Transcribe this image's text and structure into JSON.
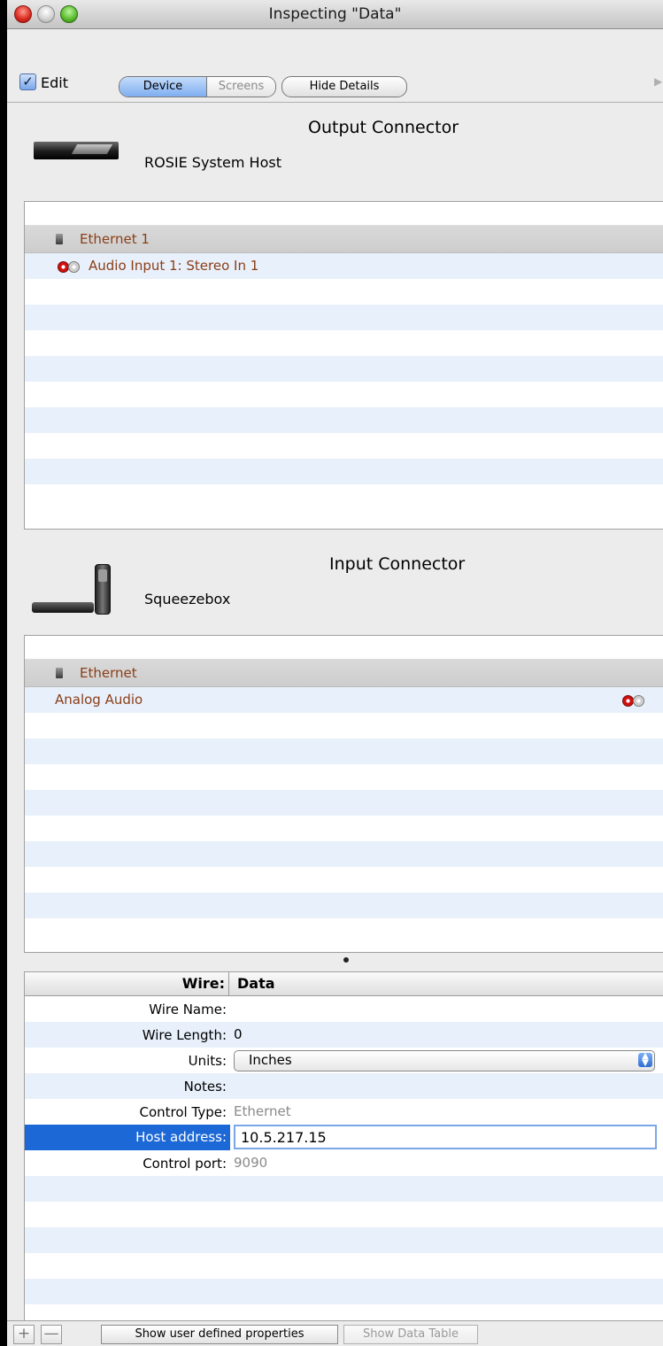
{
  "window": {
    "title": "Inspecting \"Data\""
  },
  "toolbar": {
    "edit_label": "Edit",
    "edit_checked": true,
    "segments": [
      "Device",
      "Screens"
    ],
    "selected_segment": "Device",
    "hide_details_label": "Hide Details"
  },
  "output": {
    "heading": "Output Connector",
    "device_name": "ROSIE System Host",
    "group": "Ethernet 1",
    "rows": [
      {
        "label": "Audio Input 1: Stereo In 1"
      }
    ]
  },
  "input": {
    "heading": "Input Connector",
    "device_name": "Squeezebox",
    "group": "Ethernet",
    "rows": [
      {
        "label": "Analog Audio"
      }
    ]
  },
  "wire": {
    "header_label": "Wire:",
    "header_value": "Data",
    "fields": {
      "wire_name": {
        "label": "Wire Name:",
        "value": ""
      },
      "wire_length": {
        "label": "Wire Length:",
        "value": "0"
      },
      "units": {
        "label": "Units:",
        "value": "Inches"
      },
      "notes": {
        "label": "Notes:",
        "value": ""
      },
      "control_type": {
        "label": "Control Type:",
        "value": "Ethernet"
      },
      "host_address": {
        "label": "Host address:",
        "value": "10.5.217.15"
      },
      "control_port": {
        "label": "Control port:",
        "value": "9090"
      }
    }
  },
  "bottom": {
    "add_label": "+",
    "remove_label": "—",
    "show_user_label": "Show user defined properties",
    "show_data_label": "Show Data Table"
  },
  "colors": {
    "connector_text": "#8a3e16",
    "selection": "#1c68d6",
    "row_alt": "#e8f0fb"
  }
}
